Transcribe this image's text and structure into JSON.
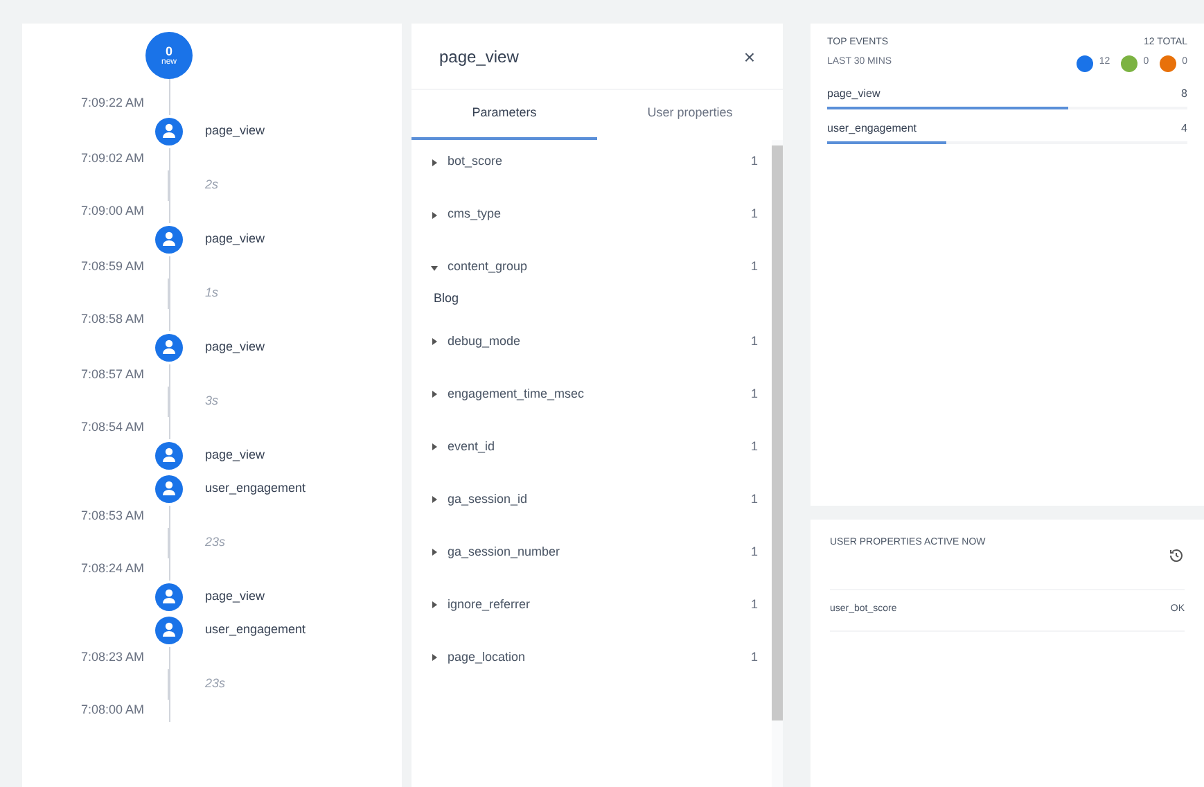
{
  "timeline": {
    "new_count": "0",
    "new_label": "new",
    "items": [
      {
        "kind": "time",
        "text": "7:09:22 AM"
      },
      {
        "kind": "event",
        "text": "page_view"
      },
      {
        "kind": "time",
        "text": "7:09:02 AM"
      },
      {
        "kind": "gap",
        "text": "2s"
      },
      {
        "kind": "time",
        "text": "7:09:00 AM"
      },
      {
        "kind": "event",
        "text": "page_view"
      },
      {
        "kind": "time",
        "text": "7:08:59 AM"
      },
      {
        "kind": "gap",
        "text": "1s"
      },
      {
        "kind": "time",
        "text": "7:08:58 AM"
      },
      {
        "kind": "event",
        "text": "page_view"
      },
      {
        "kind": "time",
        "text": "7:08:57 AM"
      },
      {
        "kind": "gap",
        "text": "3s"
      },
      {
        "kind": "time",
        "text": "7:08:54 AM"
      },
      {
        "kind": "event",
        "text": "page_view"
      },
      {
        "kind": "event",
        "text": "user_engagement"
      },
      {
        "kind": "time",
        "text": "7:08:53 AM"
      },
      {
        "kind": "gap",
        "text": "23s"
      },
      {
        "kind": "time",
        "text": "7:08:24 AM"
      },
      {
        "kind": "event",
        "text": "page_view"
      },
      {
        "kind": "event",
        "text": "user_engagement"
      },
      {
        "kind": "time",
        "text": "7:08:23 AM"
      },
      {
        "kind": "gap",
        "text": "23s"
      },
      {
        "kind": "time",
        "text": "7:08:00 AM"
      }
    ]
  },
  "details": {
    "title": "page_view",
    "close": "×",
    "tabs": [
      {
        "label": "Parameters",
        "selected": true
      },
      {
        "label": "User properties",
        "selected": false
      }
    ],
    "parameters": [
      {
        "name": "bot_score",
        "count": "1",
        "expanded": false
      },
      {
        "name": "cms_type",
        "count": "1",
        "expanded": false
      },
      {
        "name": "content_group",
        "count": "1",
        "expanded": true,
        "value": "Blog"
      },
      {
        "name": "debug_mode",
        "count": "1",
        "expanded": false
      },
      {
        "name": "engagement_time_msec",
        "count": "1",
        "expanded": false
      },
      {
        "name": "event_id",
        "count": "1",
        "expanded": false
      },
      {
        "name": "ga_session_id",
        "count": "1",
        "expanded": false
      },
      {
        "name": "ga_session_number",
        "count": "1",
        "expanded": false
      },
      {
        "name": "ignore_referrer",
        "count": "1",
        "expanded": false
      },
      {
        "name": "page_location",
        "count": "1",
        "expanded": false
      }
    ]
  },
  "top_events": {
    "title": "TOP EVENTS",
    "total": "12 TOTAL",
    "period": "LAST 30 MINS",
    "badges": [
      {
        "count": "12",
        "color": "#1a73e8"
      },
      {
        "count": "0",
        "color": "#7cb342"
      },
      {
        "count": "0",
        "color": "#e8710a"
      }
    ],
    "events": [
      {
        "name": "page_view",
        "count": "8",
        "level": 0.67
      },
      {
        "name": "user_engagement",
        "count": "4",
        "level": 0.33
      }
    ]
  },
  "user_properties": {
    "title": "USER PROPERTIES ACTIVE NOW",
    "rows": [
      {
        "name": "user_bot_score",
        "value": "OK"
      }
    ]
  }
}
